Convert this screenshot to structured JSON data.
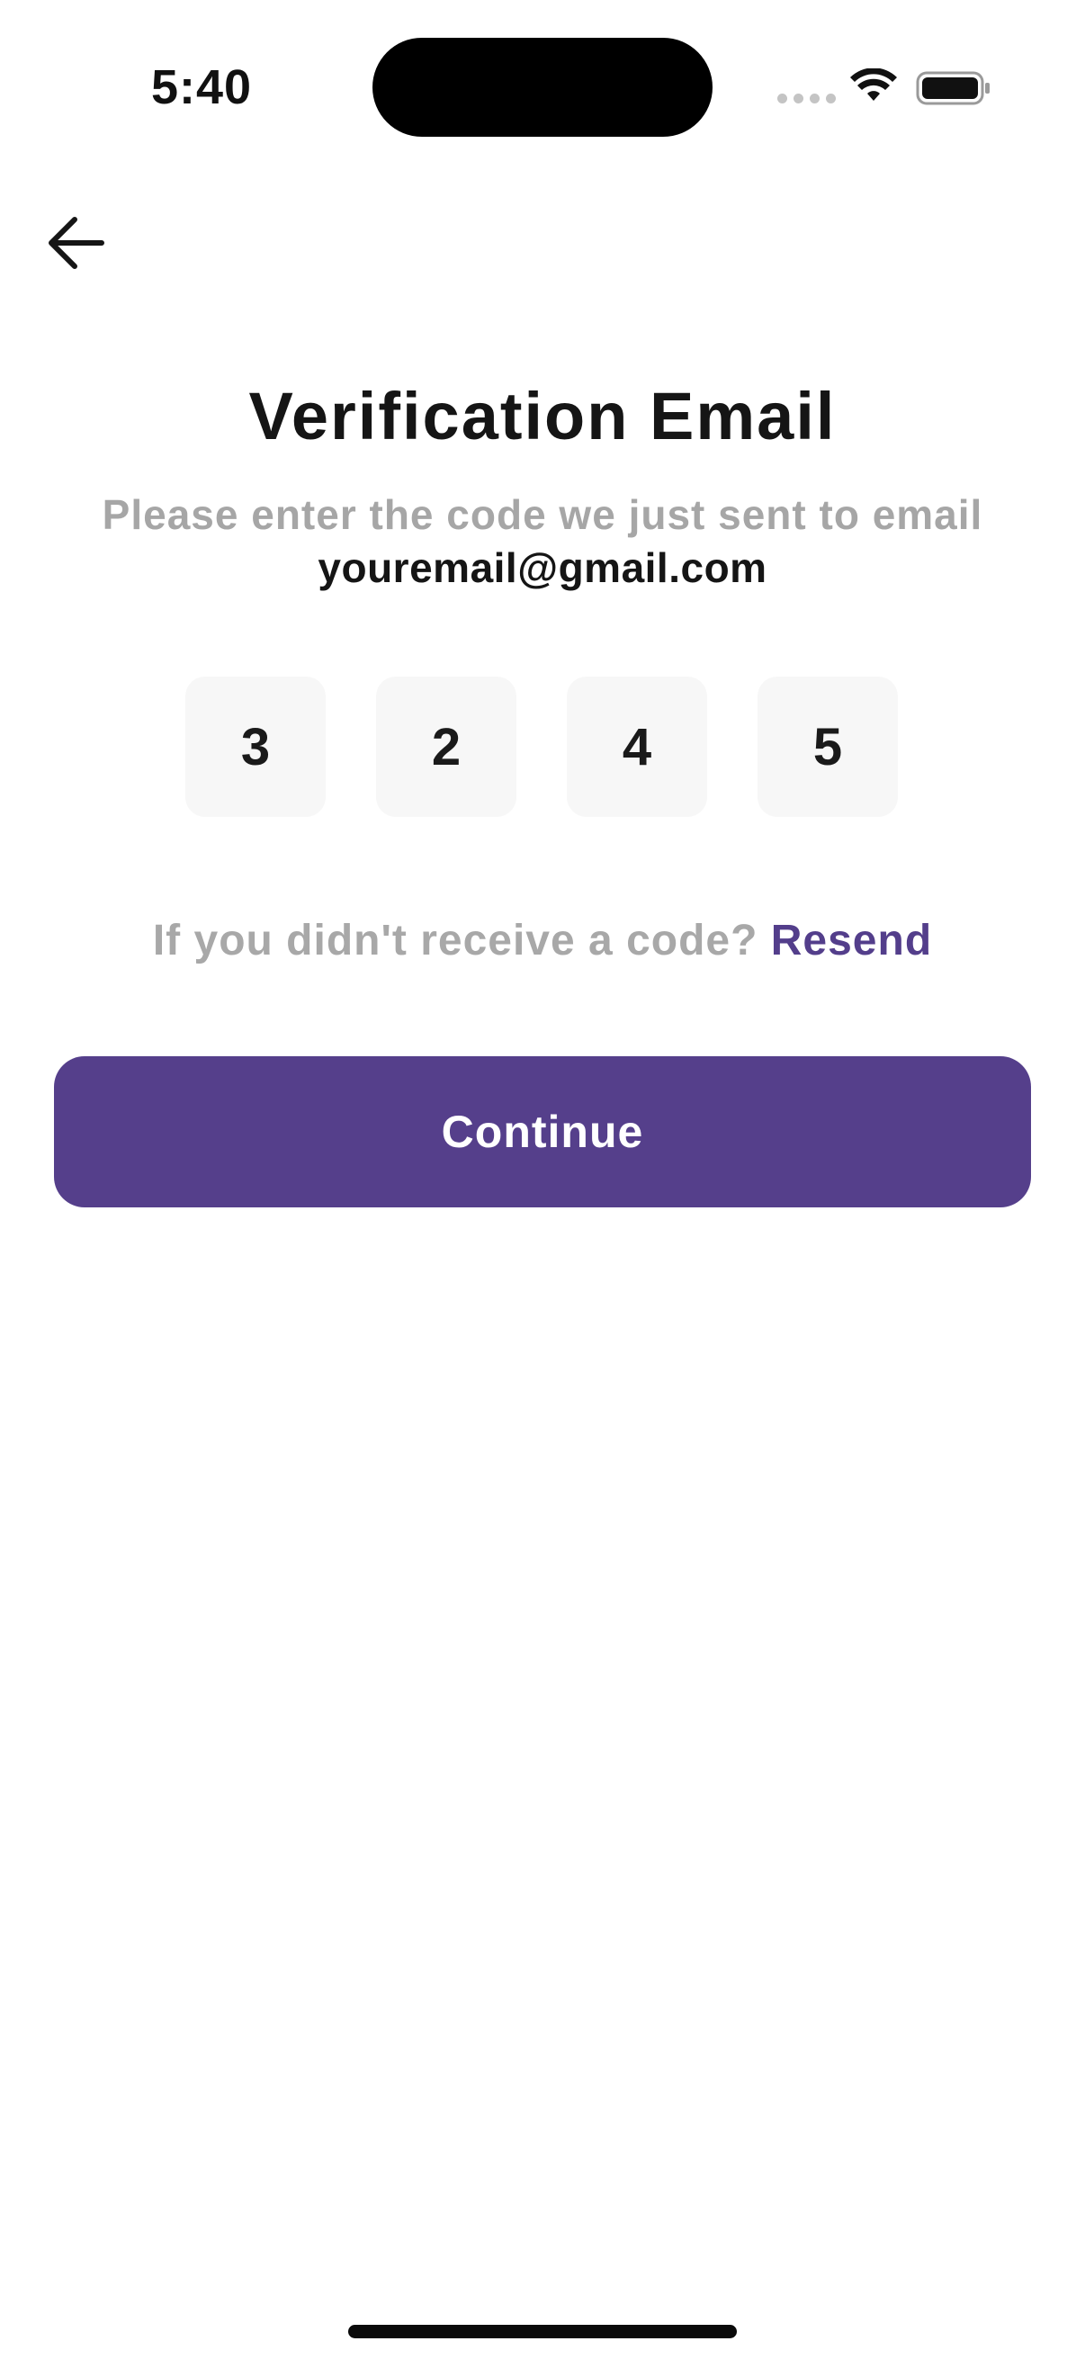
{
  "status_bar": {
    "time": "5:40",
    "icons": [
      "cellular-dots-icon",
      "wifi-icon",
      "battery-icon"
    ]
  },
  "nav": {
    "back_icon": "arrow-left-icon"
  },
  "header": {
    "title": "Verification Email",
    "subtitle": "Please enter the code we just sent to email",
    "email": "youremail@gmail.com"
  },
  "otp": {
    "digits": [
      "3",
      "2",
      "4",
      "5"
    ]
  },
  "resend": {
    "prompt": "If you didn't receive a code?",
    "link_label": "Resend"
  },
  "actions": {
    "continue_label": "Continue"
  },
  "colors": {
    "accent": "#553f8b",
    "muted_text": "#a6a6a6",
    "otp_box_bg": "#f7f7f7"
  }
}
